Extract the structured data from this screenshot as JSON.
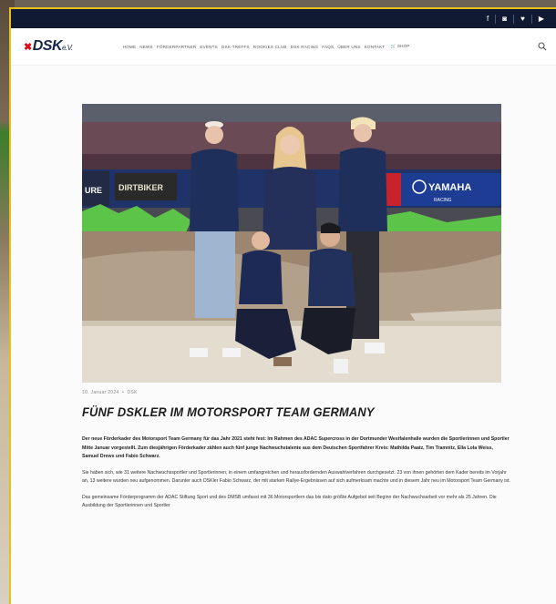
{
  "topbar": {
    "social": [
      {
        "icon": "facebook-icon",
        "glyph": "f"
      },
      {
        "icon": "instagram-icon",
        "glyph": "◙"
      },
      {
        "icon": "twitter-icon",
        "glyph": "♥"
      },
      {
        "icon": "youtube-icon",
        "glyph": "▶"
      }
    ]
  },
  "header": {
    "logo_main": "DSK",
    "logo_suffix": "e.V.",
    "menu": [
      "Home",
      "News",
      "Förderpartner",
      "Events",
      "DSK-Treffs",
      "Rookies Club",
      "DSK Racing",
      "FAQs",
      "Über uns",
      "Kontakt"
    ],
    "shop_label": "Shop"
  },
  "article": {
    "date": "10. Januar 2024",
    "category": "DSK",
    "title": "Fünf DSKler im Motorsport Team Germany",
    "lead": "Der neue Förderkader des Motorsport Team Germany für das Jahr 2021 steht fest: Im Rahmen des ADAC Supercross in der Dortmunder Westfalenhalle wurden die Sportlerinnen und Sportler Mitte Januar vorgestellt. Zum diesjährigen Förderkader zählen auch fünf junge Nachwuchstalente aus dem Deutschen Sportfahrer Kreis: Mathilda Paatz, Tim Tramnitz, Ella Lola Weiss, Samuel Drews und Fabio Schwarz.",
    "para1": "Sie haben sich, wie 31 weitere Nachwuchssportler und Sportlerinnen, in einem umfangreichen und herausfordernden Auswahlverfahren durchgesetzt. 23 von ihnen gehörten dem Kader bereits im Vorjahr an, 13 weitere wurden neu aufgenommen. Darunter auch DSKler Fabio Schwarz, der mit starken Rallye-Ergebnissen auf sich aufmerksam machte und in diesem Jahr neu im Motorsport Team Germany ist.",
    "para2": "Das gemeinsame Förderprogramm der ADAC Stiftung Sport und des DMSB umfasst mit 36 Motorsportlern das bis dato größte Aufgebot seit Beginn der Nachwuchsarbeit vor mehr als 25 Jahren. Die Ausbildung der Sportlerinnen und Sportler"
  },
  "hero": {
    "banners": [
      "URE",
      "DIRTBIKER",
      "YAMAHA",
      "RACING"
    ]
  },
  "colors": {
    "topbar": "#101b33",
    "accent_red": "#e30613",
    "brand_navy": "#16254a",
    "frame_border": "#e9c01a"
  }
}
